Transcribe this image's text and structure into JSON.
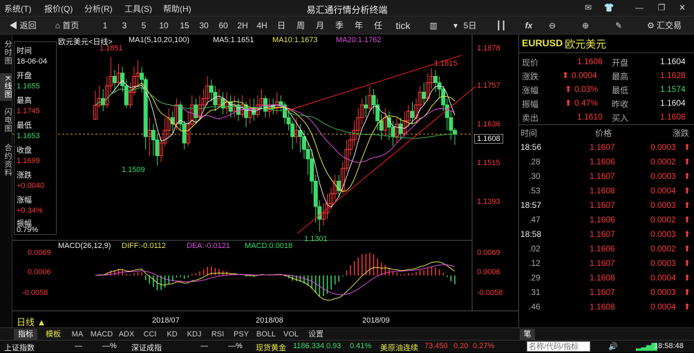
{
  "menu": [
    "系统(T)",
    "报价(Q)",
    "分析(R)",
    "工具(S)",
    "帮助(H)"
  ],
  "app_title": "易汇通行情分析终端",
  "toolbar": {
    "back": "返回",
    "home": "首页",
    "periods": [
      "1",
      "3",
      "5",
      "10",
      "15",
      "30",
      "60",
      "2H",
      "4H",
      "日",
      "周",
      "月",
      "季",
      "年",
      "任",
      "tick"
    ],
    "five_day": "5日",
    "trade": "汇交易"
  },
  "side_tabs": [
    "分时图",
    "K线图",
    "闪电图",
    "合约资料"
  ],
  "info": {
    "time_label": "时间",
    "time": "18-06-04",
    "open_label": "开盘",
    "open": "1.1655",
    "high_label": "最高",
    "high": "1.1745",
    "low_label": "最低",
    "low": "1.1653",
    "close_label": "收盘",
    "close": "1.1699",
    "change_label": "涨跌",
    "change": "+0.0040",
    "pct_label": "涨幅",
    "pct": "+0.34%",
    "amp_label": "振幅",
    "amp": "0.79%"
  },
  "chart_header": {
    "name": "欧元美元<日线>",
    "ma_def": "MA1(5,10,20,100)",
    "ma5": "MA5:1.1651",
    "ma10": "MA10:1.1673",
    "ma20": "MA20:1.1762"
  },
  "price_axis": [
    "1.1878",
    "1.1757",
    "1.1636",
    "1.1515",
    "1.1393"
  ],
  "current_price": "1.1608",
  "annotations": {
    "high": "1.1851",
    "low1": "1.1509",
    "low2": "1.1301",
    "high2": "1.1815"
  },
  "macd_header": {
    "def": "MACD(26,12,9)",
    "diff": "DIFF:-0.0112",
    "dea": "DEA:-0.0121",
    "macd": "MACD:0.0018"
  },
  "macd_axis": [
    "0.0069",
    "0.0006",
    "-0.0058"
  ],
  "date_axis": [
    "2018/07",
    "2018/08",
    "2018/09"
  ],
  "period_label": "日线",
  "quote": {
    "symbol": "EURUSD",
    "name": "欧元美元",
    "rows": [
      {
        "l1": "现价",
        "v1": "1.1608",
        "l2": "开盘",
        "v2": "1.1604"
      },
      {
        "l1": "涨跌",
        "v1": "0.0004",
        "l2": "最高",
        "v2": "1.1628"
      },
      {
        "l1": "涨幅",
        "v1": "0.03%",
        "l2": "最低",
        "v2": "1.1574"
      },
      {
        "l1": "振幅",
        "v1": "0.47%",
        "l2": "昨收",
        "v2": "1.1604"
      },
      {
        "l1": "卖出",
        "v1": "1.1610",
        "l2": "买入",
        "v2": "1.1608"
      }
    ]
  },
  "ticks_header": {
    "time": "时间",
    "price": "价格",
    "change": "涨跌"
  },
  "ticks": [
    {
      "t": "18:56",
      "p": "1.1607",
      "c": "0.0003"
    },
    {
      "t": ".28",
      "p": "1.1606",
      "c": "0.0002"
    },
    {
      "t": ".30",
      "p": "1.1607",
      "c": "0.0003"
    },
    {
      "t": ".53",
      "p": "1.1608",
      "c": "0.0004"
    },
    {
      "t": "18:57",
      "p": "1.1607",
      "c": "0.0003"
    },
    {
      "t": ".47",
      "p": "1.1606",
      "c": "0.0002"
    },
    {
      "t": "18:58",
      "p": "1.1607",
      "c": "0.0003"
    },
    {
      "t": ".02",
      "p": "1.1606",
      "c": "0.0002"
    },
    {
      "t": ".12",
      "p": "1.1607",
      "c": "0.0003"
    },
    {
      "t": ".29",
      "p": "1.1608",
      "c": "0.0004"
    },
    {
      "t": ".31",
      "p": "1.1607",
      "c": "0.0003"
    },
    {
      "t": ".46",
      "p": "1.1608",
      "c": "0.0004"
    }
  ],
  "bottom_tabs": [
    "指标",
    "模板",
    "MA",
    "MACD",
    "ADX",
    "CCI",
    "KD",
    "KDJ",
    "RSI",
    "PSY",
    "BOLL",
    "VOL",
    "设置"
  ],
  "right_bottom_tab": "笔",
  "status": {
    "idx1": "上证指数",
    "idx1_v": "—",
    "idx1_p": "—%",
    "idx2": "深证成指",
    "idx2_v": "—",
    "idx2_p": "—%",
    "gold": "现货黄金",
    "gold_v": "1186.334",
    "gold_c": "0.93",
    "gold_p": "0.41%",
    "oil": "美原油连续",
    "oil_v": "73.450",
    "oil_c": "0.20",
    "oil_p": "0.27%",
    "search_placeholder": "名称/代码/指标",
    "clock": "18:58:48"
  },
  "colors": {
    "up": "#ff3b3b",
    "down": "#3cdc6c",
    "ma5": "#e8e8e8",
    "ma10": "#e8e84a",
    "ma20": "#e050e0"
  },
  "chart_data": {
    "type": "candlestick",
    "y_axis_ticks": [
      1.1878,
      1.1757,
      1.1636,
      1.1515,
      1.1393
    ],
    "candles": [
      [
        1.1655,
        1.1699,
        1.1745,
        1.1653
      ],
      [
        1.1699,
        1.172,
        1.176,
        1.169
      ],
      [
        1.172,
        1.17,
        1.175,
        1.168
      ],
      [
        1.17,
        1.176,
        1.179,
        1.169
      ],
      [
        1.176,
        1.179,
        1.1851,
        1.174
      ],
      [
        1.179,
        1.177,
        1.181,
        1.174
      ],
      [
        1.177,
        1.18,
        1.183,
        1.176
      ],
      [
        1.18,
        1.176,
        1.182,
        1.174
      ],
      [
        1.176,
        1.17,
        1.178,
        1.169
      ],
      [
        1.17,
        1.174,
        1.177,
        1.169
      ],
      [
        1.174,
        1.179,
        1.182,
        1.173
      ],
      [
        1.179,
        1.18,
        1.184,
        1.176
      ],
      [
        1.18,
        1.178,
        1.182,
        1.174
      ],
      [
        1.178,
        1.16,
        1.179,
        1.156
      ],
      [
        1.16,
        1.162,
        1.166,
        1.154
      ],
      [
        1.162,
        1.159,
        1.164,
        1.154
      ],
      [
        1.159,
        1.154,
        1.161,
        1.1509
      ],
      [
        1.154,
        1.158,
        1.16,
        1.152
      ],
      [
        1.158,
        1.162,
        1.166,
        1.157
      ],
      [
        1.162,
        1.166,
        1.169,
        1.16
      ],
      [
        1.166,
        1.164,
        1.168,
        1.161
      ],
      [
        1.164,
        1.17,
        1.172,
        1.162
      ],
      [
        1.17,
        1.164,
        1.171,
        1.162
      ],
      [
        1.164,
        1.158,
        1.165,
        1.156
      ],
      [
        1.158,
        1.164,
        1.168,
        1.157
      ],
      [
        1.164,
        1.17,
        1.173,
        1.163
      ],
      [
        1.17,
        1.166,
        1.172,
        1.164
      ],
      [
        1.166,
        1.17,
        1.173,
        1.165
      ],
      [
        1.17,
        1.172,
        1.175,
        1.168
      ],
      [
        1.172,
        1.176,
        1.179,
        1.17
      ],
      [
        1.176,
        1.174,
        1.178,
        1.171
      ],
      [
        1.174,
        1.17,
        1.176,
        1.168
      ],
      [
        1.17,
        1.172,
        1.175,
        1.169
      ],
      [
        1.172,
        1.169,
        1.174,
        1.167
      ],
      [
        1.169,
        1.171,
        1.174,
        1.167
      ],
      [
        1.171,
        1.168,
        1.173,
        1.166
      ],
      [
        1.168,
        1.17,
        1.173,
        1.166
      ],
      [
        1.17,
        1.167,
        1.172,
        1.165
      ],
      [
        1.167,
        1.17,
        1.173,
        1.166
      ],
      [
        1.17,
        1.166,
        1.171,
        1.163
      ],
      [
        1.166,
        1.169,
        1.172,
        1.164
      ],
      [
        1.169,
        1.167,
        1.172,
        1.165
      ],
      [
        1.167,
        1.17,
        1.173,
        1.166
      ],
      [
        1.17,
        1.172,
        1.175,
        1.169
      ],
      [
        1.172,
        1.168,
        1.173,
        1.166
      ],
      [
        1.168,
        1.17,
        1.172,
        1.166
      ],
      [
        1.17,
        1.169,
        1.172,
        1.167
      ],
      [
        1.169,
        1.171,
        1.174,
        1.167
      ],
      [
        1.171,
        1.17,
        1.173,
        1.168
      ],
      [
        1.17,
        1.166,
        1.171,
        1.164
      ],
      [
        1.166,
        1.164,
        1.168,
        1.162
      ],
      [
        1.164,
        1.16,
        1.165,
        1.156
      ],
      [
        1.16,
        1.162,
        1.166,
        1.158
      ],
      [
        1.162,
        1.16,
        1.164,
        1.155
      ],
      [
        1.16,
        1.156,
        1.162,
        1.153
      ],
      [
        1.156,
        1.153,
        1.158,
        1.148
      ],
      [
        1.153,
        1.146,
        1.156,
        1.142
      ],
      [
        1.146,
        1.138,
        1.148,
        1.133
      ],
      [
        1.138,
        1.134,
        1.14,
        1.1301
      ],
      [
        1.134,
        1.136,
        1.139,
        1.132
      ],
      [
        1.136,
        1.139,
        1.142,
        1.134
      ],
      [
        1.139,
        1.142,
        1.144,
        1.137
      ],
      [
        1.142,
        1.146,
        1.148,
        1.14
      ],
      [
        1.146,
        1.143,
        1.148,
        1.141
      ],
      [
        1.143,
        1.15,
        1.152,
        1.142
      ],
      [
        1.15,
        1.156,
        1.159,
        1.149
      ],
      [
        1.156,
        1.159,
        1.161,
        1.154
      ],
      [
        1.159,
        1.162,
        1.165,
        1.157
      ],
      [
        1.162,
        1.166,
        1.169,
        1.16
      ],
      [
        1.166,
        1.17,
        1.172,
        1.164
      ],
      [
        1.17,
        1.169,
        1.173,
        1.166
      ],
      [
        1.169,
        1.173,
        1.176,
        1.168
      ],
      [
        1.173,
        1.17,
        1.175,
        1.167
      ],
      [
        1.17,
        1.165,
        1.172,
        1.162
      ],
      [
        1.165,
        1.162,
        1.167,
        1.159
      ],
      [
        1.162,
        1.166,
        1.169,
        1.16
      ],
      [
        1.166,
        1.163,
        1.168,
        1.159
      ],
      [
        1.163,
        1.16,
        1.165,
        1.157
      ],
      [
        1.16,
        1.164,
        1.166,
        1.158
      ],
      [
        1.164,
        1.161,
        1.166,
        1.159
      ],
      [
        1.161,
        1.165,
        1.168,
        1.16
      ],
      [
        1.165,
        1.168,
        1.17,
        1.163
      ],
      [
        1.168,
        1.166,
        1.171,
        1.164
      ],
      [
        1.166,
        1.17,
        1.172,
        1.164
      ],
      [
        1.17,
        1.174,
        1.176,
        1.168
      ],
      [
        1.174,
        1.172,
        1.177,
        1.17
      ],
      [
        1.172,
        1.177,
        1.18,
        1.171
      ],
      [
        1.177,
        1.179,
        1.1815,
        1.175
      ],
      [
        1.179,
        1.177,
        1.181,
        1.174
      ],
      [
        1.177,
        1.175,
        1.179,
        1.172
      ],
      [
        1.175,
        1.17,
        1.176,
        1.168
      ],
      [
        1.17,
        1.166,
        1.172,
        1.162
      ],
      [
        1.166,
        1.162,
        1.168,
        1.159
      ],
      [
        1.162,
        1.1608,
        1.1628,
        1.1574
      ]
    ],
    "macd_ticks": [
      0.0069,
      0.0006,
      -0.0058
    ]
  }
}
